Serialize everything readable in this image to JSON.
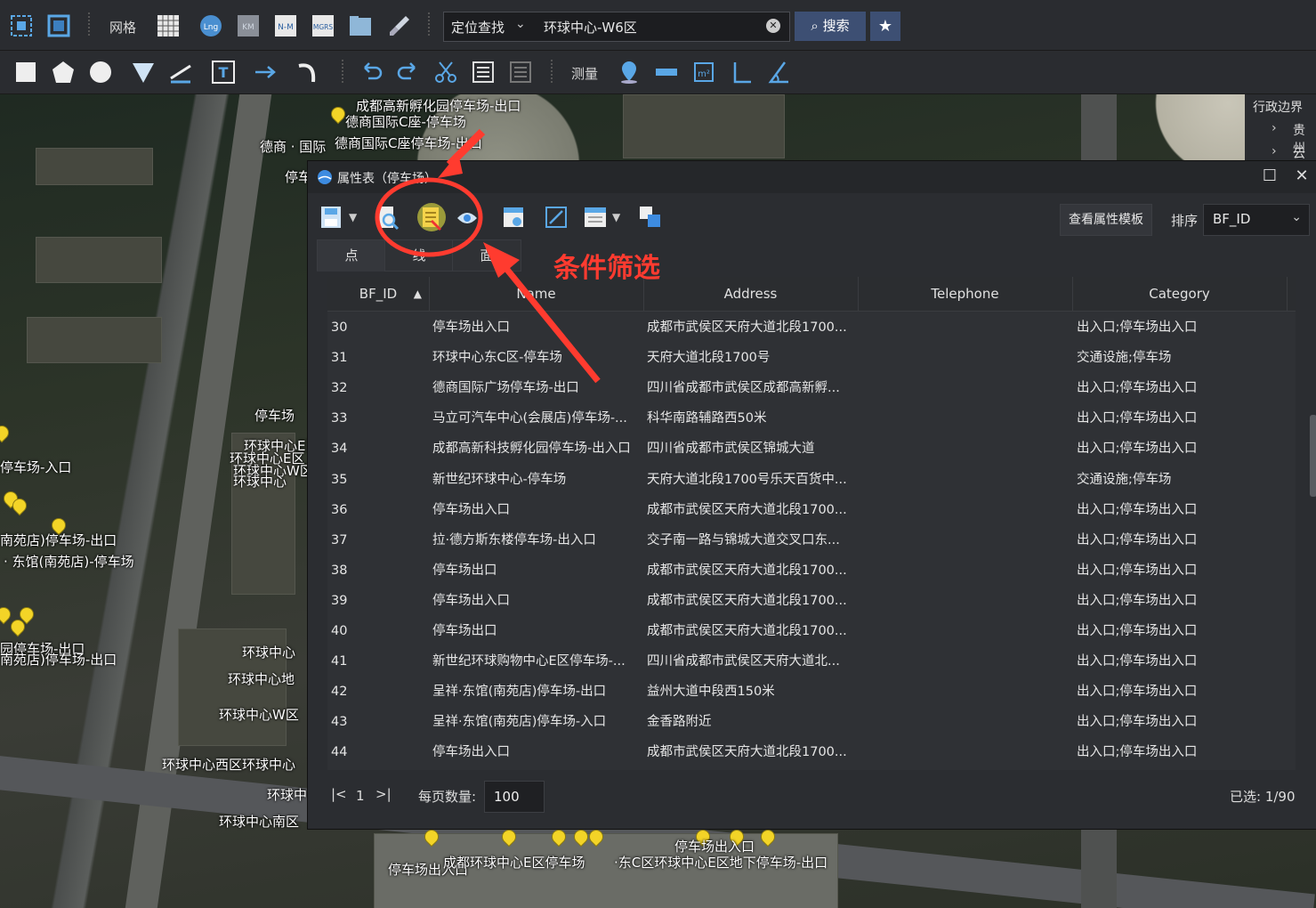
{
  "toolbar1": {
    "grid_label": "网格",
    "search_mode": "定位查找",
    "search_value": "环球中心-W6区",
    "search_button": "搜索"
  },
  "toolbar2": {
    "measure_label": "测量"
  },
  "admin_panel": {
    "title": "行政边界",
    "items": [
      "贵州",
      "云南"
    ]
  },
  "map_labels": [
    "成都高新孵化园停车场-出口",
    "德商国际C座-停车场",
    "德商 · 国际",
    "德商国际C座停车场-出口",
    "停车",
    "停车场",
    "环球中心E区",
    "环球中心E区",
    "环球中心W区",
    "环球中心",
    "停车场-入口",
    "南苑店)停车场-出口",
    "· 东馆(南苑店)-停车场",
    "园停车场-出口",
    "南苑店)停车场-出口",
    "环球中心",
    "环球中心地",
    "环球中心W区",
    "环球中心西区环球中心",
    "环球中",
    "环球中心南区",
    "停车场出入口",
    "停车场出入口",
    "成都环球中心E区停车场",
    "·东C区环球中心E区地下停车场-出口"
  ],
  "window": {
    "title": "属性表（停车场）",
    "template_button": "查看属性模板",
    "sort_label": "排序",
    "sort_value": "BF_ID",
    "tabs": [
      "点",
      "线",
      "面"
    ],
    "columns": [
      "BF_ID",
      "Name",
      "Address",
      "Telephone",
      "Category"
    ],
    "rows": [
      [
        "30",
        "停车场出入口",
        "成都市武侯区天府大道北段1700...",
        "",
        "出入口;停车场出入口"
      ],
      [
        "31",
        "环球中心东C区-停车场",
        "天府大道北段1700号",
        "",
        "交通设施;停车场"
      ],
      [
        "32",
        "德商国际广场停车场-出口",
        "四川省成都市武侯区成都高新孵...",
        "",
        "出入口;停车场出入口"
      ],
      [
        "33",
        "马立可汽车中心(会展店)停车场-...",
        "科华南路辅路西50米",
        "",
        "出入口;停车场出入口"
      ],
      [
        "34",
        "成都高新科技孵化园停车场-出入口",
        "四川省成都市武侯区锦城大道",
        "",
        "出入口;停车场出入口"
      ],
      [
        "35",
        "新世纪环球中心-停车场",
        "天府大道北段1700号乐天百货中...",
        "",
        "交通设施;停车场"
      ],
      [
        "36",
        "停车场出入口",
        "成都市武侯区天府大道北段1700...",
        "",
        "出入口;停车场出入口"
      ],
      [
        "37",
        "拉·德方斯东楼停车场-出入口",
        "交子南一路与锦城大道交叉口东...",
        "",
        "出入口;停车场出入口"
      ],
      [
        "38",
        "停车场出口",
        "成都市武侯区天府大道北段1700...",
        "",
        "出入口;停车场出入口"
      ],
      [
        "39",
        "停车场出入口",
        "成都市武侯区天府大道北段1700...",
        "",
        "出入口;停车场出入口"
      ],
      [
        "40",
        "停车场出口",
        "成都市武侯区天府大道北段1700...",
        "",
        "出入口;停车场出入口"
      ],
      [
        "41",
        "新世纪环球购物中心E区停车场-...",
        "四川省成都市武侯区天府大道北...",
        "",
        "出入口;停车场出入口"
      ],
      [
        "42",
        "呈祥·东馆(南苑店)停车场-出口",
        "益州大道中段西150米",
        "",
        "出入口;停车场出入口"
      ],
      [
        "43",
        "呈祥·东馆(南苑店)停车场-入口",
        "金香路附近",
        "",
        "出入口;停车场出入口"
      ],
      [
        "44",
        "停车场出入口",
        "成都市武侯区天府大道北段1700...",
        "",
        "出入口;停车场出入口"
      ]
    ],
    "pager": {
      "page": "1",
      "page_size_label": "每页数量:",
      "page_size": "100",
      "selected": "已选: 1/90"
    }
  },
  "annotation": {
    "text": "条件筛选",
    "color": "#ff3b30"
  }
}
